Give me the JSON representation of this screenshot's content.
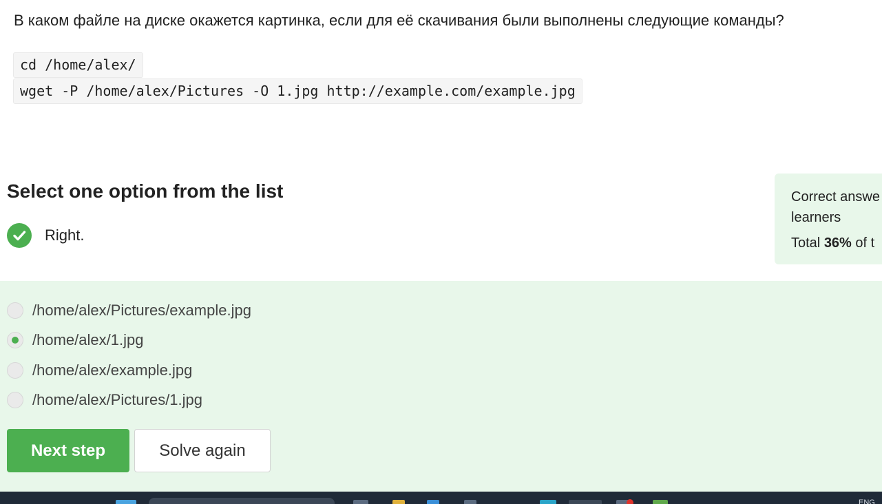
{
  "question": {
    "text": "В каком файле на диске окажется картинка, если для её скачивания были выполнены следующие команды?",
    "code": [
      "cd /home/alex/",
      "wget -P /home/alex/Pictures -O 1.jpg http://example.com/example.jpg"
    ]
  },
  "quiz": {
    "instruction": "Select one option from the list",
    "result_text": "Right.",
    "options": [
      {
        "label": "/home/alex/Pictures/example.jpg",
        "selected": false
      },
      {
        "label": "/home/alex/1.jpg",
        "selected": true
      },
      {
        "label": "/home/alex/example.jpg",
        "selected": false
      },
      {
        "label": "/home/alex/Pictures/1.jpg",
        "selected": false
      }
    ],
    "buttons": {
      "next": "Next step",
      "again": "Solve again"
    }
  },
  "stats": {
    "line1": "Correct answe",
    "line2": "learners",
    "total_prefix": "Total ",
    "total_percent": "36%",
    "total_suffix": " of t"
  },
  "taskbar": {
    "lang": "ENG"
  },
  "colors": {
    "accent": "#4caf50",
    "answer_background": "#e8f7ea",
    "taskbar": "#1f2a38"
  }
}
